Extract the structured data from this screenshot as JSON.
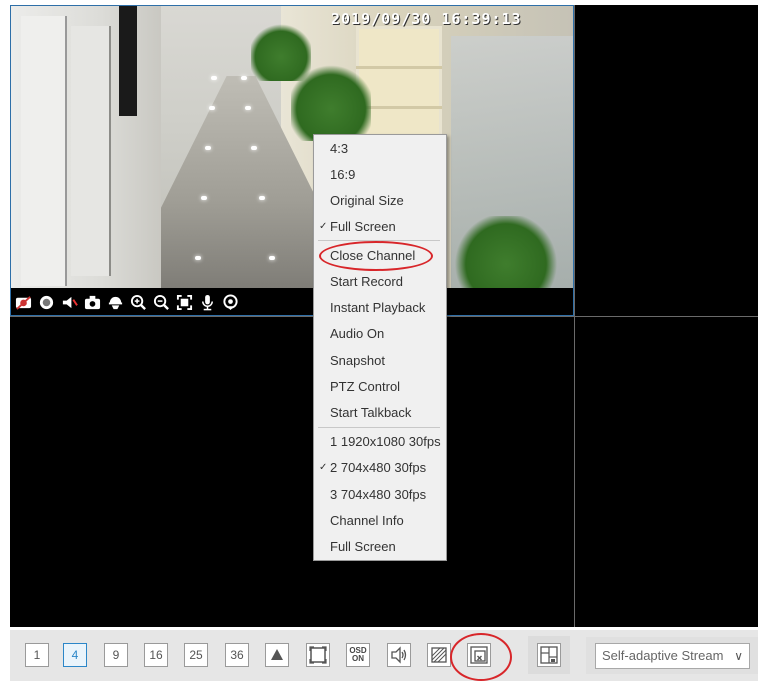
{
  "camera": {
    "timestamp": "2019/09/30  16:39:13"
  },
  "camera_toolbar": {
    "icons": [
      "record-off-icon",
      "record-dot-icon",
      "audio-mute-icon",
      "snapshot-icon",
      "ptz-icon",
      "zoom-in-icon",
      "zoom-out-icon",
      "fit-screen-icon",
      "microphone-icon",
      "location-icon"
    ]
  },
  "context_menu": {
    "items": [
      {
        "label": "4:3",
        "checked": false
      },
      {
        "label": "16:9",
        "checked": false
      },
      {
        "label": "Original Size",
        "checked": false
      },
      {
        "label": "Full Screen",
        "checked": true
      },
      {
        "label": "Close Channel",
        "checked": false,
        "highlighted": true
      },
      {
        "label": "Start Record",
        "checked": false
      },
      {
        "label": "Instant Playback",
        "checked": false
      },
      {
        "label": "Audio On",
        "checked": false
      },
      {
        "label": "Snapshot",
        "checked": false
      },
      {
        "label": "PTZ Control",
        "checked": false
      },
      {
        "label": "Start Talkback",
        "checked": false
      },
      {
        "label": "1 1920x1080 30fps",
        "checked": false
      },
      {
        "label": "2 704x480 30fps",
        "checked": true
      },
      {
        "label": "3 704x480 30fps",
        "checked": false
      },
      {
        "label": "Channel Info",
        "checked": false
      },
      {
        "label": "Full Screen",
        "checked": false
      }
    ],
    "check_mark": "✓"
  },
  "bottom_bar": {
    "layouts": [
      "1",
      "4",
      "9",
      "16",
      "25",
      "36"
    ],
    "selected_layout": "4",
    "osd_label_top": "OSD",
    "osd_label_bottom": "ON",
    "stream_select": "Self-adaptive Stream"
  },
  "colors": {
    "highlight_circle": "#d8262a",
    "selected_border": "#2b86c8",
    "grid_line": "#6a6a6a"
  }
}
